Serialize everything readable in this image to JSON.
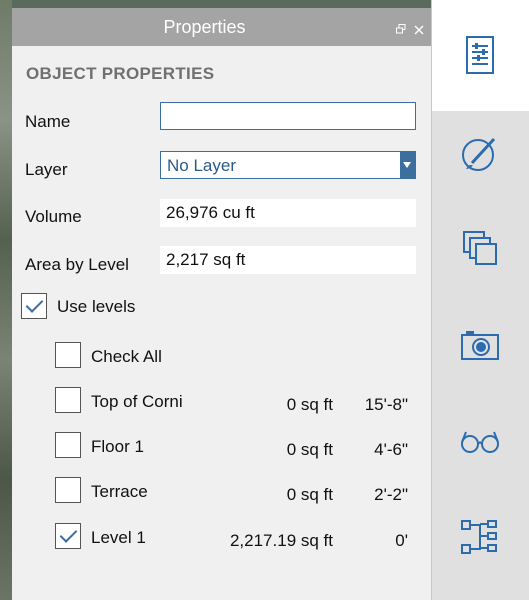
{
  "panel": {
    "title": "Properties",
    "section_title": "OBJECT PROPERTIES"
  },
  "fields": {
    "name_label": "Name",
    "name_value": "",
    "layer_label": "Layer",
    "layer_value": "No Layer",
    "volume_label": "Volume",
    "volume_value": "26,976 cu ft",
    "area_label": "Area by Level",
    "area_value": "2,217 sq ft"
  },
  "levels": {
    "use_levels_label": "Use levels",
    "use_levels_checked": true,
    "check_all_label": "Check All",
    "items": [
      {
        "name": "Top of Corni",
        "area": "0 sq ft",
        "height": "15'-8\"",
        "checked": false
      },
      {
        "name": "Floor 1",
        "area": "0 sq ft",
        "height": "4'-6\"",
        "checked": false
      },
      {
        "name": "Terrace",
        "area": "0 sq ft",
        "height": "2'-2\"",
        "checked": false
      },
      {
        "name": "Level 1",
        "area": "2,217.19 sq ft",
        "height": "0'",
        "checked": true
      }
    ]
  },
  "sidebar": {
    "icons": [
      "properties-icon",
      "brush-icon",
      "pages-icon",
      "camera-icon",
      "glasses-icon",
      "hierarchy-icon"
    ],
    "active_index": 0
  },
  "colors": {
    "accent": "#3d6f9e",
    "titlebar": "#a4a4a4",
    "sidebar_icon": "#2b6cb0"
  }
}
